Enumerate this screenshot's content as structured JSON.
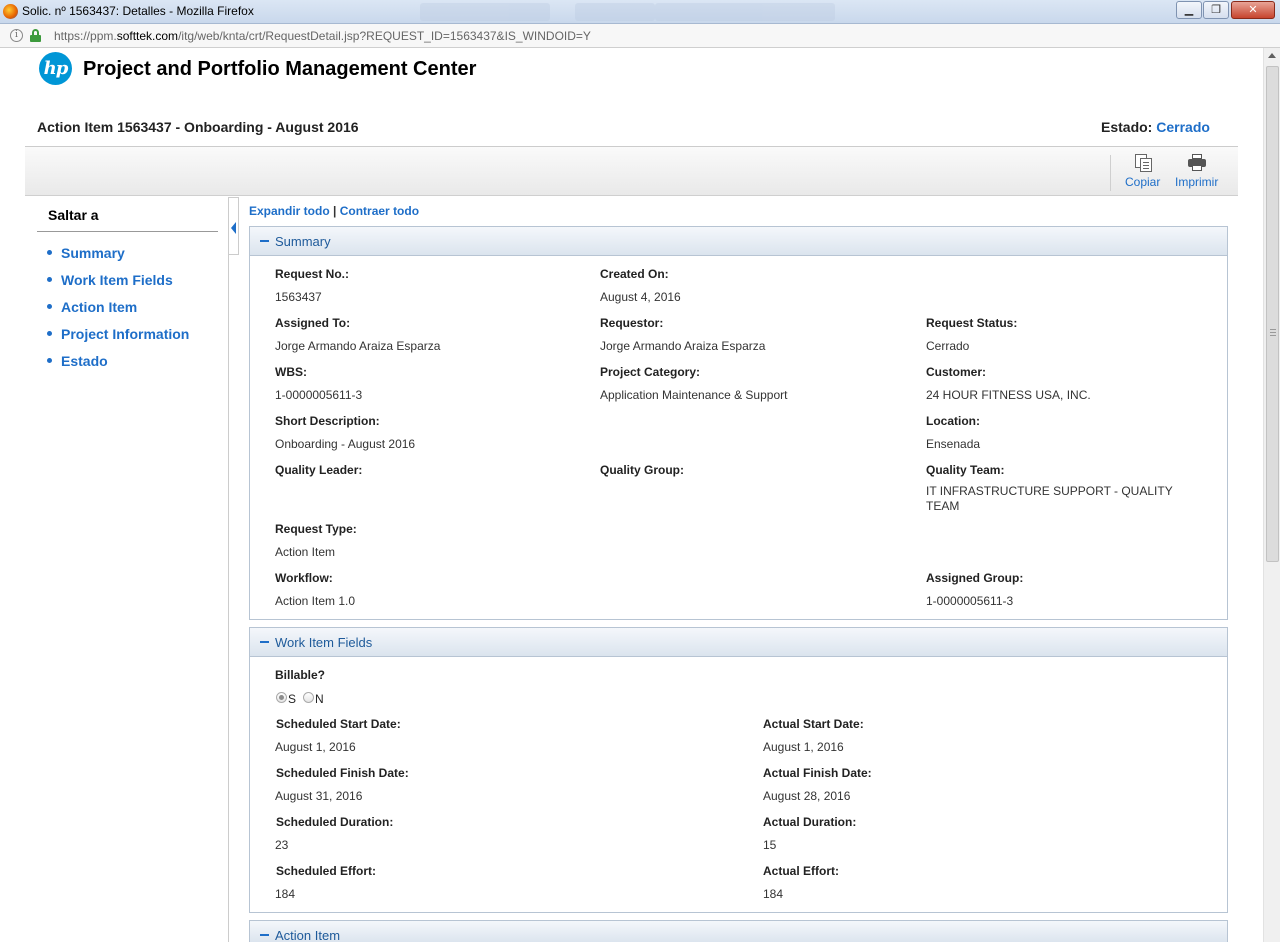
{
  "window": {
    "title": "Solic. nº 1563437: Detalles - Mozilla Firefox",
    "buttons": {
      "minimize": "▁",
      "maximize": "❐",
      "close": "✕"
    }
  },
  "address": {
    "url_prefix": "https://ppm.",
    "url_host": "softtek.com",
    "url_path": "/itg/web/knta/crt/RequestDetail.jsp?REQUEST_ID=1563437&IS_WINDOID=Y"
  },
  "header": {
    "logo_text": "hp",
    "app_title": "Project and Portfolio Management Center",
    "page_title": "Action Item 1563437 - Onboarding - August 2016",
    "status_label": "Estado:",
    "status_value": "Cerrado"
  },
  "toolbar": {
    "copy_label": "Copiar",
    "print_label": "Imprimir"
  },
  "nav": {
    "heading": "Saltar a",
    "items": [
      "Summary",
      "Work Item Fields",
      "Action Item",
      "Project Information",
      "Estado"
    ]
  },
  "links": {
    "expand_all": "Expandir todo",
    "separator": "|",
    "collapse_all": "Contraer todo"
  },
  "summary": {
    "title": "Summary",
    "request_no_label": "Request No.:",
    "request_no": "1563437",
    "created_on_label": "Created On:",
    "created_on": "August 4, 2016",
    "assigned_to_label": "Assigned To:",
    "assigned_to": "Jorge Armando Araiza Esparza",
    "requestor_label": "Requestor:",
    "requestor": "Jorge Armando Araiza Esparza",
    "request_status_label": "Request Status:",
    "request_status": "Cerrado",
    "wbs_label": "WBS:",
    "wbs": "1-0000005611-3",
    "project_category_label": "Project Category:",
    "project_category": "Application Maintenance & Support",
    "customer_label": "Customer:",
    "customer": "24 HOUR FITNESS USA, INC.",
    "short_description_label": "Short Description:",
    "short_description": "Onboarding - August 2016",
    "location_label": "Location:",
    "location": "Ensenada",
    "quality_leader_label": "Quality Leader:",
    "quality_group_label": "Quality Group:",
    "quality_team_label": "Quality Team:",
    "quality_team": "IT INFRASTRUCTURE SUPPORT - QUALITY TEAM",
    "request_type_label": "Request Type:",
    "request_type": "Action Item",
    "workflow_label": "Workflow:",
    "workflow": "Action Item 1.0",
    "assigned_group_label": "Assigned Group:",
    "assigned_group": "1-0000005611-3"
  },
  "work_item_fields": {
    "title": "Work Item Fields",
    "billable_label": "Billable?",
    "billable_options": [
      "S",
      "N"
    ],
    "billable_selected": "S",
    "scheduled_start_label": "Scheduled Start Date:",
    "scheduled_start": "August 1, 2016",
    "actual_start_label": "Actual Start Date:",
    "actual_start": "August 1, 2016",
    "scheduled_finish_label": "Scheduled Finish Date:",
    "scheduled_finish": "August 31, 2016",
    "actual_finish_label": "Actual Finish Date:",
    "actual_finish": "August 28, 2016",
    "scheduled_duration_label": "Scheduled Duration:",
    "scheduled_duration": "23",
    "actual_duration_label": "Actual Duration:",
    "actual_duration": "15",
    "scheduled_effort_label": "Scheduled Effort:",
    "scheduled_effort": "184",
    "actual_effort_label": "Actual Effort:",
    "actual_effort": "184"
  },
  "action_item": {
    "title": "Action Item"
  },
  "colors": {
    "link": "#1e6ec8",
    "hp_blue": "#0096d6",
    "section_border": "#b7c4d3"
  }
}
